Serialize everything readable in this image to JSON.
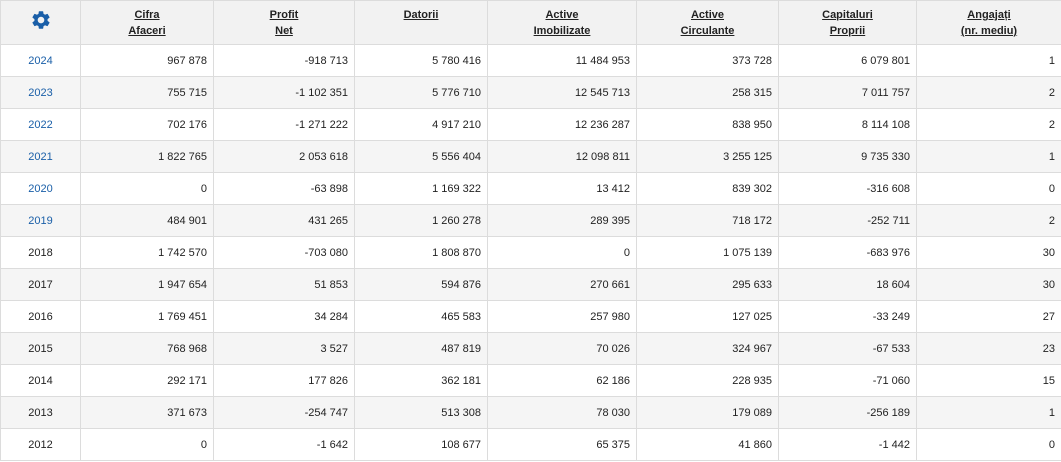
{
  "header": {
    "settings_icon": "gear-icon",
    "accent_color": "#1a5fa8",
    "columns": [
      {
        "line1": "Cifra",
        "line2": "Afaceri"
      },
      {
        "line1": "Profit",
        "line2": "Net"
      },
      {
        "line1": "Datorii",
        "line2": ""
      },
      {
        "line1": "Active",
        "line2": "Imobilizate"
      },
      {
        "line1": "Active",
        "line2": "Circulante"
      },
      {
        "line1": "Capitaluri",
        "line2": "Proprii"
      },
      {
        "line1": "Angajați",
        "line2": "(nr. mediu)"
      }
    ]
  },
  "rows": [
    {
      "year": "2024",
      "link": true,
      "values": [
        "967 878",
        "-918 713",
        "5 780 416",
        "11 484 953",
        "373 728",
        "6 079 801",
        "1"
      ]
    },
    {
      "year": "2023",
      "link": true,
      "values": [
        "755 715",
        "-1 102 351",
        "5 776 710",
        "12 545 713",
        "258 315",
        "7 011 757",
        "2"
      ]
    },
    {
      "year": "2022",
      "link": true,
      "values": [
        "702 176",
        "-1 271 222",
        "4 917 210",
        "12 236 287",
        "838 950",
        "8 114 108",
        "2"
      ]
    },
    {
      "year": "2021",
      "link": true,
      "values": [
        "1 822 765",
        "2 053 618",
        "5 556 404",
        "12 098 811",
        "3 255 125",
        "9 735 330",
        "1"
      ]
    },
    {
      "year": "2020",
      "link": true,
      "values": [
        "0",
        "-63 898",
        "1 169 322",
        "13 412",
        "839 302",
        "-316 608",
        "0"
      ]
    },
    {
      "year": "2019",
      "link": true,
      "values": [
        "484 901",
        "431 265",
        "1 260 278",
        "289 395",
        "718 172",
        "-252 711",
        "2"
      ]
    },
    {
      "year": "2018",
      "link": false,
      "values": [
        "1 742 570",
        "-703 080",
        "1 808 870",
        "0",
        "1 075 139",
        "-683 976",
        "30"
      ]
    },
    {
      "year": "2017",
      "link": false,
      "values": [
        "1 947 654",
        "51 853",
        "594 876",
        "270 661",
        "295 633",
        "18 604",
        "30"
      ]
    },
    {
      "year": "2016",
      "link": false,
      "values": [
        "1 769 451",
        "34 284",
        "465 583",
        "257 980",
        "127 025",
        "-33 249",
        "27"
      ]
    },
    {
      "year": "2015",
      "link": false,
      "values": [
        "768 968",
        "3 527",
        "487 819",
        "70 026",
        "324 967",
        "-67 533",
        "23"
      ]
    },
    {
      "year": "2014",
      "link": false,
      "values": [
        "292 171",
        "177 826",
        "362 181",
        "62 186",
        "228 935",
        "-71 060",
        "15"
      ]
    },
    {
      "year": "2013",
      "link": false,
      "values": [
        "371 673",
        "-254 747",
        "513 308",
        "78 030",
        "179 089",
        "-256 189",
        "1"
      ]
    },
    {
      "year": "2012",
      "link": false,
      "values": [
        "0",
        "-1 642",
        "108 677",
        "65 375",
        "41 860",
        "-1 442",
        "0"
      ]
    }
  ]
}
